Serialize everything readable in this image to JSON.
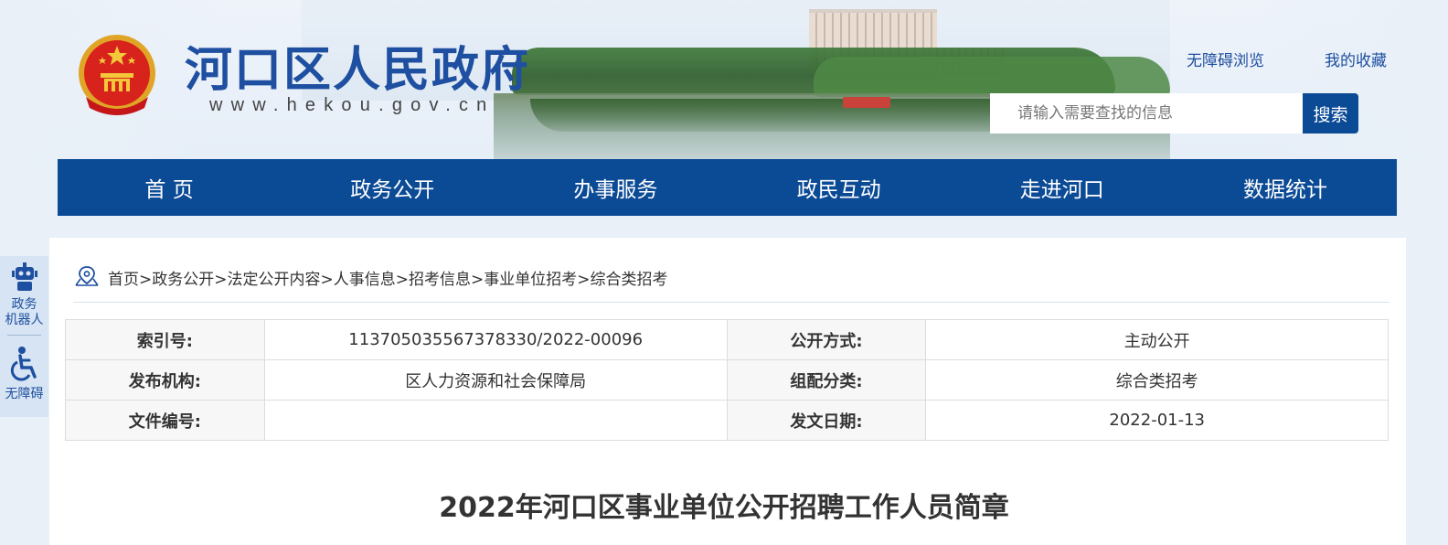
{
  "header": {
    "site_title": "河口区人民政府",
    "site_url": "www.hekou.gov.cn",
    "links": {
      "accessible": "无障碍浏览",
      "favorites": "我的收藏"
    },
    "search": {
      "placeholder": "请输入需要查找的信息",
      "button": "搜索"
    }
  },
  "nav": [
    "首 页",
    "政务公开",
    "办事服务",
    "政民互动",
    "走进河口",
    "数据统计"
  ],
  "side": {
    "robot": "政务\n机器人",
    "robot_l1": "政务",
    "robot_l2": "机器人",
    "accessibility": "无障碍"
  },
  "breadcrumb": "首页>政务公开>法定公开内容>人事信息>招考信息>事业单位招考>综合类招考",
  "meta": [
    {
      "label1": "索引号:",
      "value1": "113705035567378330/2022-00096",
      "label2": "公开方式:",
      "value2": "主动公开"
    },
    {
      "label1": "发布机构:",
      "value1": "区人力资源和社会保障局",
      "label2": "组配分类:",
      "value2": "综合类招考"
    },
    {
      "label1": "文件编号:",
      "value1": "",
      "label2": "发文日期:",
      "value2": "2022-01-13"
    }
  ],
  "article": {
    "title": "2022年河口区事业单位公开招聘工作人员简章"
  },
  "colors": {
    "brand_blue": "#0b4a95",
    "title_blue": "#1e4fa0"
  }
}
